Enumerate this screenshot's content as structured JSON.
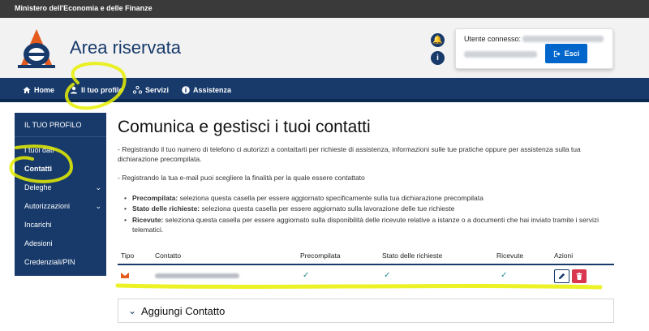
{
  "topbar": {
    "ministry": "Ministero dell'Economia e delle Finanze"
  },
  "header": {
    "title": "Area riservata"
  },
  "user": {
    "label": "Utente connesso:",
    "logout_label": "Esci"
  },
  "nav": {
    "items": [
      {
        "label": "Home",
        "icon": "home-icon"
      },
      {
        "label": "Il tuo profilo",
        "icon": "user-icon"
      },
      {
        "label": "Servizi",
        "icon": "services-icon"
      },
      {
        "label": "Assistenza",
        "icon": "info-icon"
      }
    ]
  },
  "sidebar": {
    "title": "IL TUO PROFILO",
    "items": [
      {
        "label": "I tuoi dati"
      },
      {
        "label": "Contatti"
      },
      {
        "label": "Deleghe"
      },
      {
        "label": "Autorizzazioni"
      },
      {
        "label": "Incarichi"
      },
      {
        "label": "Adesioni"
      },
      {
        "label": "Credenziali/PIN"
      }
    ]
  },
  "main": {
    "title": "Comunica e gestisci i tuoi contatti",
    "intro1_line1": "- Registrando il tuo numero di telefono ci autorizzi a contattarti per richieste di assistenza, informazioni sulle tue pratiche oppure per assistenza sulla tua",
    "intro1_line2": "dichiarazione precompilata.",
    "intro2": "- Registrando la tua e-mail puoi scegliere la finalità per la quale essere contattato",
    "bullets": [
      {
        "term": "Precompilata:",
        "text": " seleziona questa casella per essere aggiornato specificamente sulla tua dichiarazione precompilata"
      },
      {
        "term": "Stato delle richieste:",
        "text": " seleziona questa casella per essere aggiornato sulla lavorazione delle tue richieste"
      },
      {
        "term": "Ricevute:",
        "text": " seleziona questa casella per essere aggiornato sulla disponibilità delle ricevute relative a istanze o a documenti che hai inviato tramite i servizi"
      }
    ],
    "bullet3_line2": "telematici.",
    "table": {
      "headers": [
        "Tipo",
        "Contatto",
        "Precompilata",
        "Stato delle richieste",
        "Ricevute",
        "Azioni"
      ]
    },
    "accordion_title": "Aggiungi Contatto"
  },
  "colors": {
    "brand": "#173a6b",
    "action": "#0066cc",
    "danger": "#d9364f",
    "highlight": "#e8f000"
  }
}
